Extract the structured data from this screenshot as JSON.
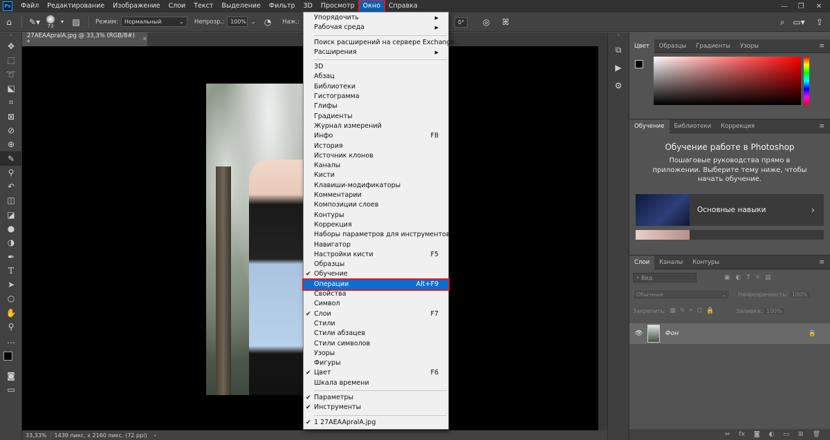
{
  "menubar": {
    "logo": "Ps",
    "items": [
      "Файл",
      "Редактирование",
      "Изображение",
      "Слои",
      "Текст",
      "Выделение",
      "Фильтр",
      "3D",
      "Просмотр",
      "Окно",
      "Справка"
    ],
    "active_index": 9
  },
  "options_bar": {
    "brush_size": "73",
    "mode_label": "Режим:",
    "mode_value": "Нормальный",
    "opacity_label": "Непрозр.:",
    "opacity_value": "100%",
    "press_label": "Наж.:",
    "angle_value": "0°"
  },
  "document_tab": {
    "title": "27AEAApralA.jpg @ 33,3% (RGB/8#) *"
  },
  "statusbar": {
    "zoom": "33,33%",
    "doc_info": "1439 пикс. x 2160 пикс. (72 ppi)"
  },
  "window_menu": {
    "items": [
      {
        "label": "Упорядочить",
        "submenu": true
      },
      {
        "label": "Рабочая среда",
        "submenu": true
      },
      {
        "sep": true
      },
      {
        "label": "Поиск расширений на сервере Exchange..."
      },
      {
        "label": "Расширения",
        "submenu": true
      },
      {
        "sep": true
      },
      {
        "label": "3D"
      },
      {
        "label": "Абзац"
      },
      {
        "label": "Библиотеки"
      },
      {
        "label": "Гистограмма"
      },
      {
        "label": "Глифы"
      },
      {
        "label": "Градиенты"
      },
      {
        "label": "Журнал измерений"
      },
      {
        "label": "Инфо",
        "shortcut": "F8"
      },
      {
        "label": "История"
      },
      {
        "label": "Источник клонов"
      },
      {
        "label": "Каналы"
      },
      {
        "label": "Кисти"
      },
      {
        "label": "Клавиши-модификаторы"
      },
      {
        "label": "Комментарии"
      },
      {
        "label": "Композиции слоев"
      },
      {
        "label": "Контуры"
      },
      {
        "label": "Коррекция"
      },
      {
        "label": "Наборы параметров для инструментов"
      },
      {
        "label": "Навигатор"
      },
      {
        "label": "Настройки кисти",
        "shortcut": "F5"
      },
      {
        "label": "Образцы"
      },
      {
        "label": "Обучение",
        "checked": true
      },
      {
        "label": "Операции",
        "shortcut": "Alt+F9",
        "highlighted": true
      },
      {
        "label": "Свойства"
      },
      {
        "label": "Символ"
      },
      {
        "label": "Слои",
        "shortcut": "F7",
        "checked": true
      },
      {
        "label": "Стили"
      },
      {
        "label": "Стили абзацев"
      },
      {
        "label": "Стили символов"
      },
      {
        "label": "Узоры"
      },
      {
        "label": "Фигуры"
      },
      {
        "label": "Цвет",
        "shortcut": "F6",
        "checked": true
      },
      {
        "label": "Шкала времени"
      },
      {
        "sep": true
      },
      {
        "label": "Параметры",
        "checked": true
      },
      {
        "label": "Инструменты",
        "checked": true
      },
      {
        "sep": true
      },
      {
        "label": "1 27AEAApralA.jpg",
        "checked": true
      }
    ]
  },
  "color_panel": {
    "tabs": [
      "Цвет",
      "Образцы",
      "Градиенты",
      "Узоры"
    ],
    "active": 0,
    "accent": "#ff0000"
  },
  "learn_panel": {
    "tabs": [
      "Обучение",
      "Библиотеки",
      "Коррекция"
    ],
    "active": 0,
    "title": "Обучение работе в Photoshop",
    "subtitle": "Пошаговые руководства прямо в приложении. Выберите тему ниже, чтобы начать обучение.",
    "course_name": "Основные навыки"
  },
  "layers_panel": {
    "tabs": [
      "Слои",
      "Каналы",
      "Контуры"
    ],
    "active": 0,
    "search_placeholder": "Вид",
    "blend_mode": "Обычные",
    "opacity_label": "Непрозрачность:",
    "opacity_value": "100%",
    "lock_label": "Закрепить:",
    "fill_label": "Заливка:",
    "fill_value": "100%",
    "layer_name": "Фон"
  },
  "icons": {
    "tools": [
      "move-icon",
      "marquee-icon",
      "lasso-icon",
      "quick-select-icon",
      "crop-icon",
      "frame-icon",
      "eyedropper-icon",
      "healing-icon",
      "brush-icon",
      "stamp-icon",
      "history-brush-icon",
      "eraser-icon",
      "gradient-icon",
      "blur-icon",
      "dodge-icon",
      "pen-icon",
      "type-icon",
      "path-select-icon",
      "shape-icon",
      "hand-icon",
      "zoom-icon",
      "more-icon"
    ]
  }
}
